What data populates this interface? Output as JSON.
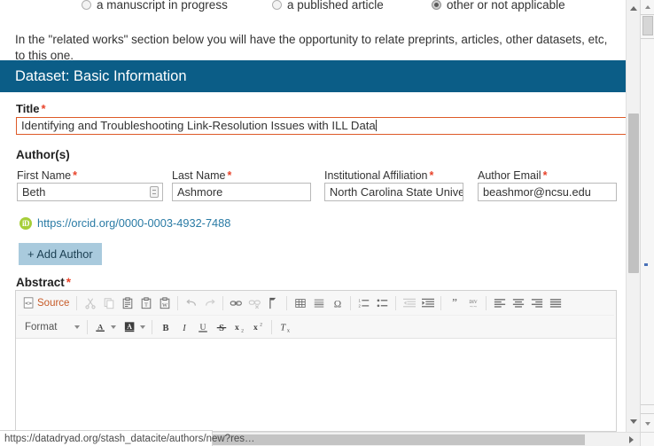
{
  "radio_group": {
    "options": [
      {
        "label": "a manuscript in progress",
        "checked": false
      },
      {
        "label": "a published article",
        "checked": false
      },
      {
        "label": "other or not applicable",
        "checked": true
      }
    ]
  },
  "helper_text": "In the \"related works\" section below you will have the opportunity to relate preprints, articles, other datasets, etc, to this one.",
  "section": {
    "header": "Dataset: Basic Information"
  },
  "title_field": {
    "label": "Title",
    "required_mark": "*",
    "value": "Identifying and Troubleshooting Link-Resolution Issues with ILL Data"
  },
  "authors": {
    "group_label": "Author(s)",
    "required_mark": "*",
    "fields": {
      "first_name": {
        "label": "First Name",
        "value": "Beth"
      },
      "last_name": {
        "label": "Last Name",
        "value": "Ashmore"
      },
      "institution": {
        "label": "Institutional Affiliation",
        "value": "North Carolina State Univer"
      },
      "email": {
        "label": "Author Email",
        "value": "beashmor@ncsu.edu"
      }
    },
    "orcid": {
      "icon_label": "iD",
      "url": "https://orcid.org/0000-0003-4932-7488",
      "color": "#a6ce39"
    },
    "add_author_label": "+ Add Author"
  },
  "abstract": {
    "label": "Abstract",
    "required_mark": "*",
    "editor": {
      "source_label": "Source",
      "format_label": "Format",
      "body_text": "",
      "toolbar_row1": [
        {
          "name": "source-button",
          "kind": "label"
        },
        {
          "name": "separator"
        },
        {
          "name": "cut-icon",
          "kind": "icon",
          "disabled": true
        },
        {
          "name": "copy-icon",
          "kind": "icon",
          "disabled": true
        },
        {
          "name": "paste-icon",
          "kind": "icon",
          "disabled": false
        },
        {
          "name": "paste-as-plain-text-icon",
          "kind": "icon",
          "disabled": false
        },
        {
          "name": "paste-from-word-icon",
          "kind": "icon",
          "disabled": false
        },
        {
          "name": "separator"
        },
        {
          "name": "undo-icon",
          "kind": "icon",
          "disabled": true
        },
        {
          "name": "redo-icon",
          "kind": "icon",
          "disabled": true
        },
        {
          "name": "separator"
        },
        {
          "name": "link-icon",
          "kind": "icon",
          "disabled": false
        },
        {
          "name": "unlink-icon",
          "kind": "icon",
          "disabled": true
        },
        {
          "name": "anchor-icon",
          "kind": "icon",
          "disabled": false
        },
        {
          "name": "separator"
        },
        {
          "name": "table-icon",
          "kind": "icon",
          "disabled": false
        },
        {
          "name": "horizontal-rule-icon",
          "kind": "icon",
          "disabled": false
        },
        {
          "name": "special-character-icon",
          "kind": "icon",
          "disabled": false
        },
        {
          "name": "separator"
        },
        {
          "name": "numbered-list-icon",
          "kind": "icon",
          "disabled": false
        },
        {
          "name": "bulleted-list-icon",
          "kind": "icon",
          "disabled": false
        },
        {
          "name": "separator"
        },
        {
          "name": "decrease-indent-icon",
          "kind": "icon",
          "disabled": true
        },
        {
          "name": "increase-indent-icon",
          "kind": "icon",
          "disabled": false
        },
        {
          "name": "separator"
        },
        {
          "name": "block-quote-icon",
          "kind": "icon",
          "disabled": false
        },
        {
          "name": "div-container-icon",
          "kind": "icon",
          "disabled": false
        },
        {
          "name": "separator"
        },
        {
          "name": "align-left-icon",
          "kind": "icon",
          "disabled": false
        },
        {
          "name": "align-center-icon",
          "kind": "icon",
          "disabled": false
        },
        {
          "name": "align-right-icon",
          "kind": "icon",
          "disabled": false
        },
        {
          "name": "align-justify-icon",
          "kind": "icon",
          "disabled": false
        }
      ],
      "toolbar_row2": [
        {
          "name": "format-dropdown",
          "kind": "dropdown"
        },
        {
          "name": "separator"
        },
        {
          "name": "text-color-icon",
          "kind": "icon",
          "disabled": false
        },
        {
          "name": "background-color-icon",
          "kind": "icon",
          "disabled": false
        },
        {
          "name": "separator"
        },
        {
          "name": "bold-icon",
          "kind": "icon",
          "disabled": false
        },
        {
          "name": "italic-icon",
          "kind": "icon",
          "disabled": false
        },
        {
          "name": "underline-icon",
          "kind": "icon",
          "disabled": false
        },
        {
          "name": "strikethrough-icon",
          "kind": "icon",
          "disabled": false
        },
        {
          "name": "subscript-icon",
          "kind": "icon",
          "disabled": false
        },
        {
          "name": "superscript-icon",
          "kind": "icon",
          "disabled": false
        },
        {
          "name": "separator"
        },
        {
          "name": "remove-format-icon",
          "kind": "icon",
          "disabled": false
        }
      ]
    }
  },
  "status_bar": {
    "url": "https://datadryad.org/stash_datacite/authors/new?res…"
  },
  "colors": {
    "section_header_bg": "#0b5d87",
    "required_star": "#e8432a",
    "focused_input_border": "#dd5a28",
    "add_author_bg": "#a9cadd",
    "link": "#2a7ba5"
  }
}
